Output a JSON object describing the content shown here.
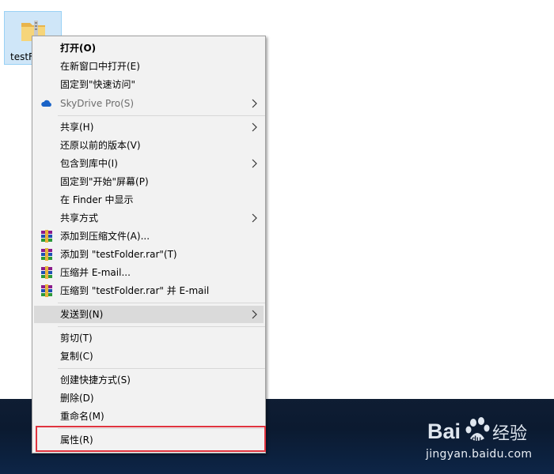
{
  "desktop": {
    "icon_label": "testFolder"
  },
  "menu": {
    "items": [
      {
        "label": "打开(O)"
      },
      {
        "label": "在新窗口中打开(E)"
      },
      {
        "label": "固定到\"快速访问\""
      },
      {
        "label": "SkyDrive Pro(S)"
      },
      {
        "label": "共享(H)"
      },
      {
        "label": "还原以前的版本(V)"
      },
      {
        "label": "包含到库中(I)"
      },
      {
        "label": "固定到\"开始\"屏幕(P)"
      },
      {
        "label": "在 Finder 中显示"
      },
      {
        "label": "共享方式"
      },
      {
        "label": "添加到压缩文件(A)..."
      },
      {
        "label": "添加到 \"testFolder.rar\"(T)"
      },
      {
        "label": "压缩并 E-mail..."
      },
      {
        "label": "压缩到 \"testFolder.rar\" 并 E-mail"
      },
      {
        "label": "发送到(N)"
      },
      {
        "label": "剪切(T)"
      },
      {
        "label": "复制(C)"
      },
      {
        "label": "创建快捷方式(S)"
      },
      {
        "label": "删除(D)"
      },
      {
        "label": "重命名(M)"
      },
      {
        "label": "属性(R)"
      }
    ]
  },
  "watermark": {
    "logo_text": "Bai 经验",
    "url": "jingyan.baidu.com"
  },
  "colors": {
    "menu_bg": "#f2f2f2",
    "highlight": "#dadada",
    "red_outline": "#e0343f",
    "band": "#0f1d33"
  },
  "icons": {
    "skydrive": "cloud-icon",
    "winrar": "winrar-icon",
    "submenu": "chevron-right-icon",
    "folder": "folder-icon"
  }
}
